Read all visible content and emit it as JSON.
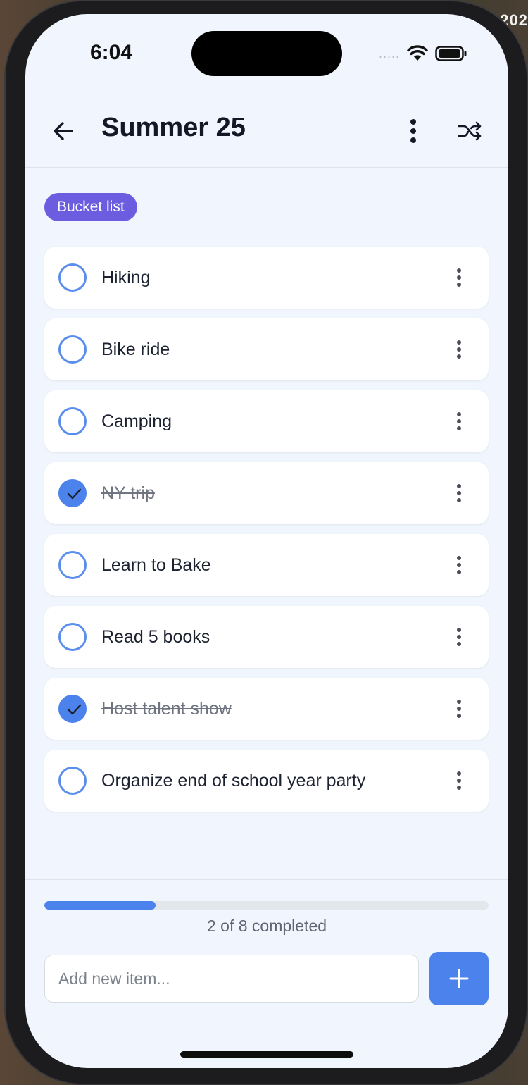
{
  "background": {
    "corner_text": "202"
  },
  "status_bar": {
    "time": "6:04",
    "signal": "....."
  },
  "header": {
    "title": "Summer 25"
  },
  "tag": {
    "label": "Bucket list",
    "color": "#6b5ce0"
  },
  "items": [
    {
      "label": "Hiking",
      "done": false
    },
    {
      "label": "Bike ride",
      "done": false
    },
    {
      "label": "Camping",
      "done": false
    },
    {
      "label": "NY trip",
      "done": true
    },
    {
      "label": "Learn to Bake",
      "done": false
    },
    {
      "label": "Read 5 books",
      "done": false
    },
    {
      "label": "Host talent show",
      "done": true
    },
    {
      "label": "Organize end of school year party",
      "done": false
    }
  ],
  "progress": {
    "completed": 2,
    "total": 8,
    "fraction": 0.25,
    "text": "2 of 8 completed"
  },
  "add_item": {
    "placeholder": "Add new item..."
  },
  "colors": {
    "accent": "#4c82ec",
    "tag": "#6b5ce0",
    "background": "#f1f6fe"
  }
}
